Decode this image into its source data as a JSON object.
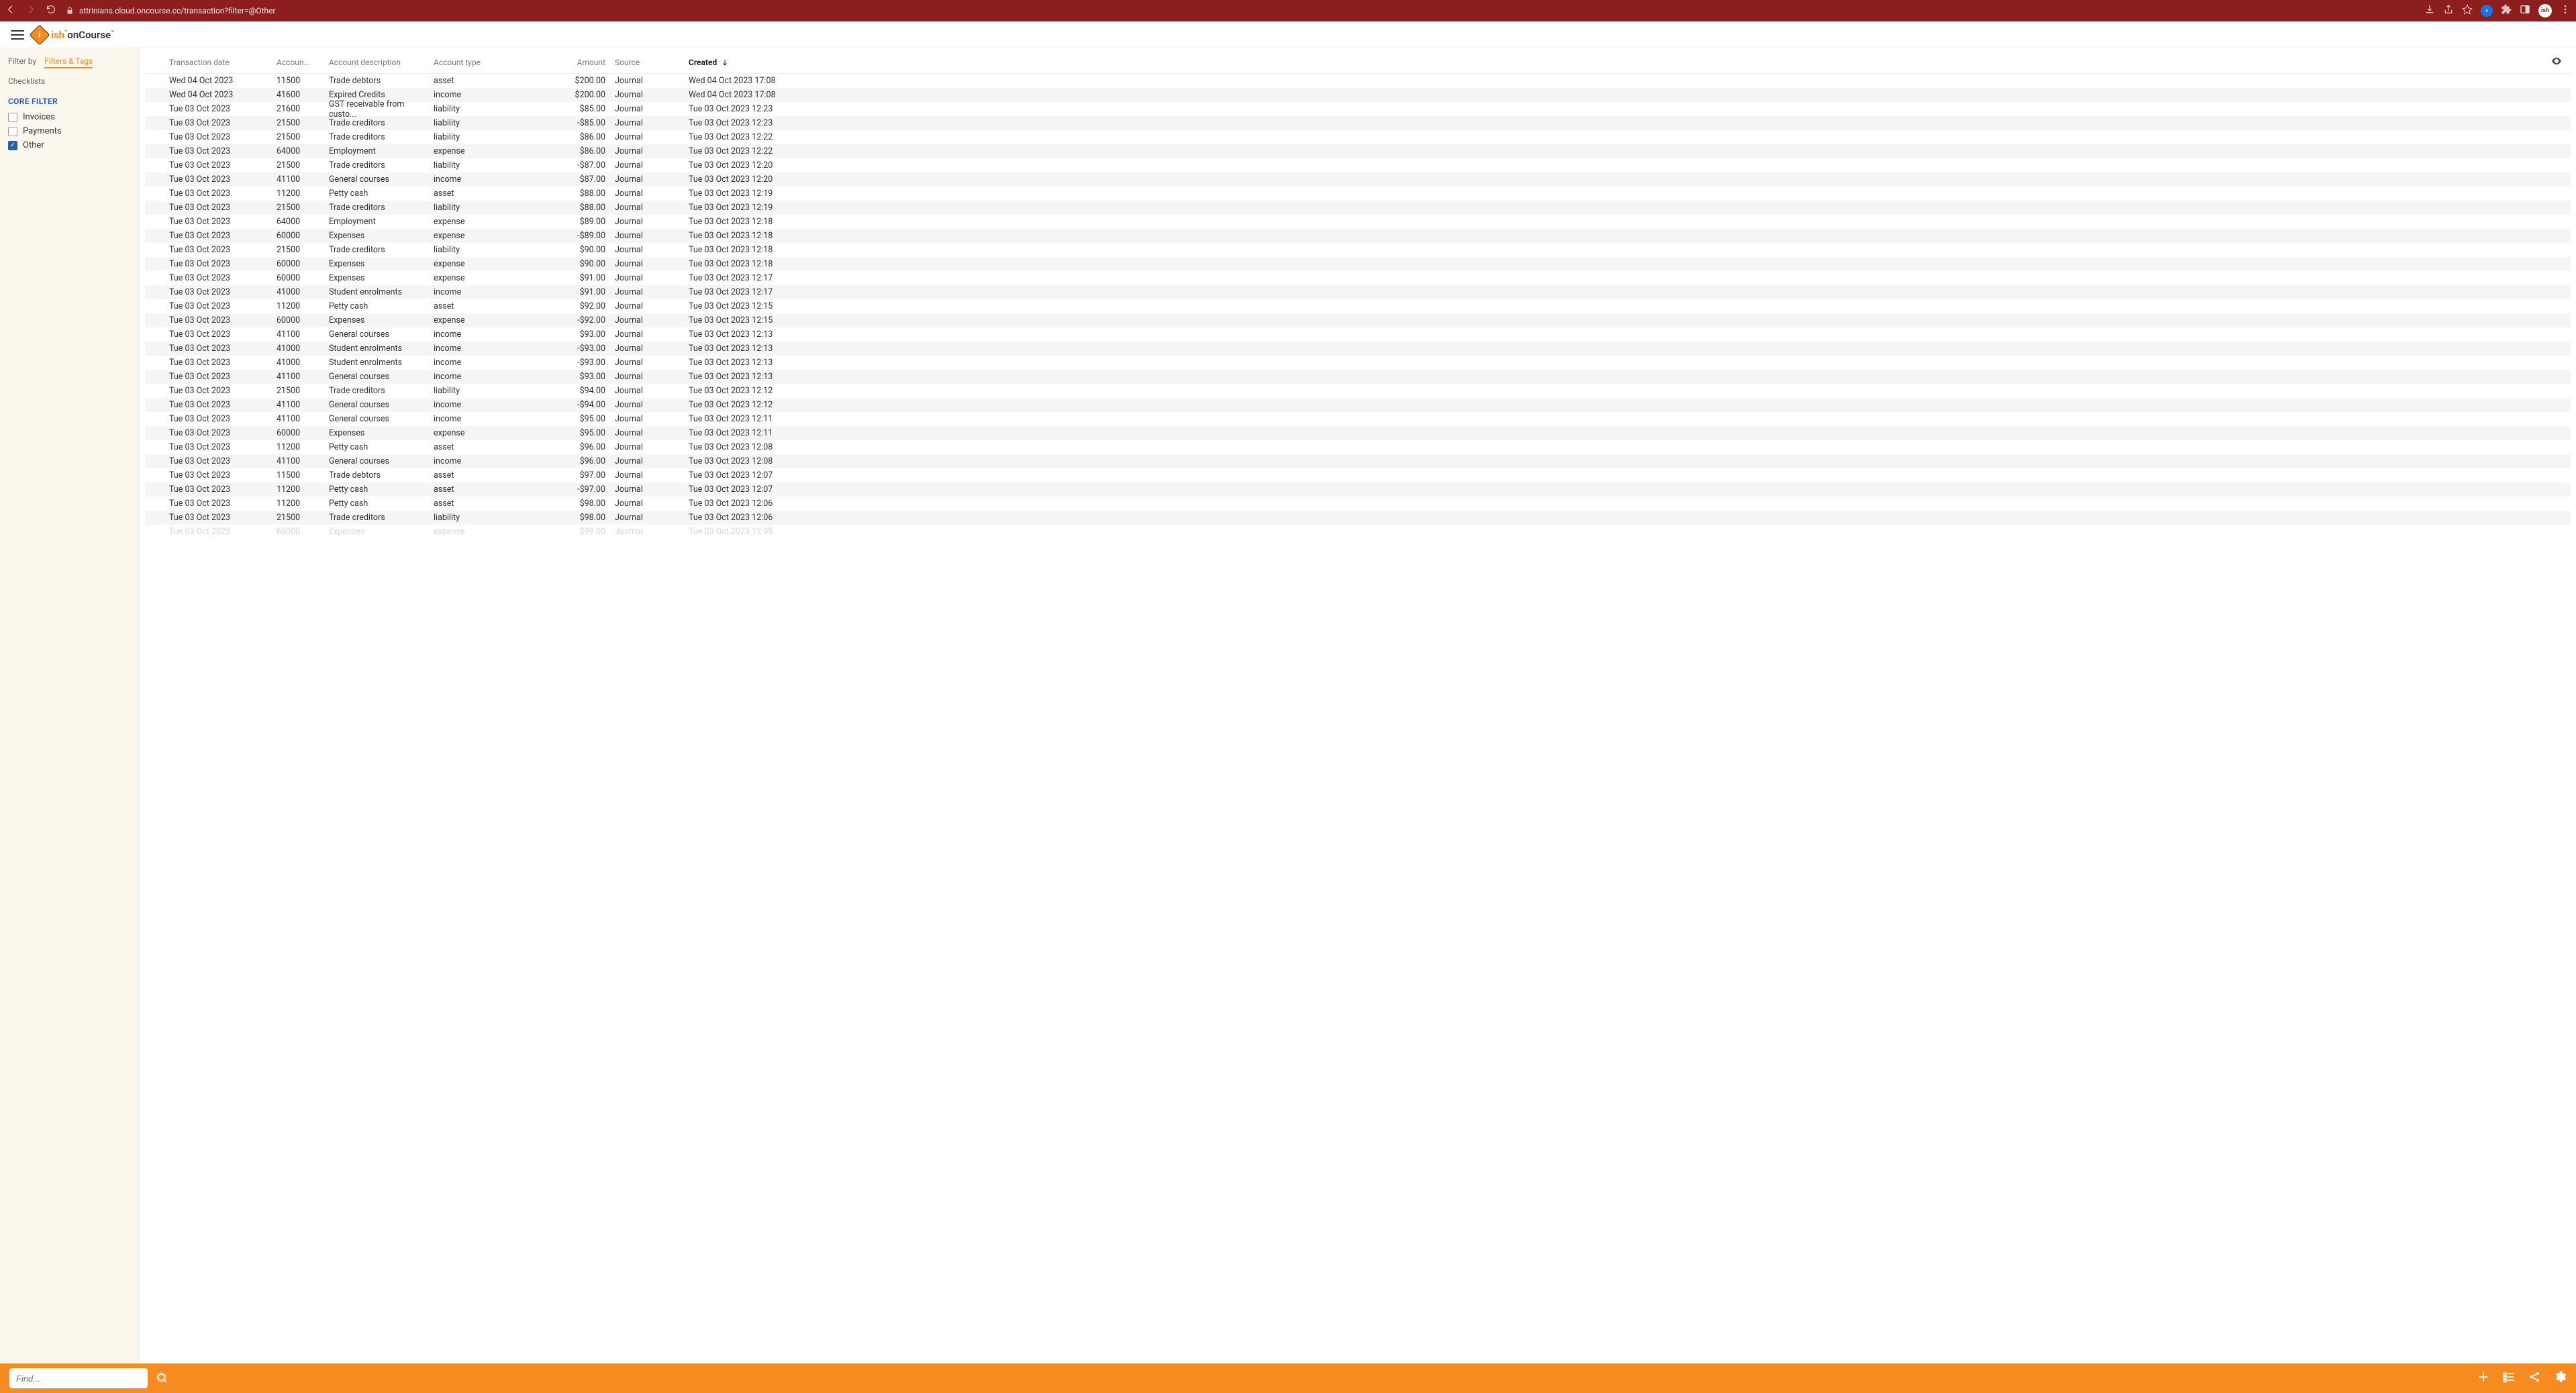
{
  "browser": {
    "url": "sttrinians.cloud.oncourse.cc/transaction?filter=@Other",
    "avatar": "ish"
  },
  "logo": {
    "ish": "ish",
    "onc": "onCourse"
  },
  "sidebar": {
    "tabs": {
      "filter_by": "Filter by",
      "filters_tags": "Filters & Tags",
      "checklists": "Checklists"
    },
    "core_title": "CORE FILTER",
    "filters": [
      {
        "label": "Invoices",
        "checked": false
      },
      {
        "label": "Payments",
        "checked": false
      },
      {
        "label": "Other",
        "checked": true
      }
    ]
  },
  "columns": {
    "date": "Transaction date",
    "accnum": "Accoun...",
    "accdesc": "Account description",
    "acctype": "Account type",
    "amount": "Amount",
    "source": "Source",
    "created": "Created"
  },
  "search_placeholder": "Find...",
  "rows": [
    {
      "date": "Wed 04 Oct 2023",
      "num": "11500",
      "desc": "Trade debtors",
      "type": "asset",
      "amount": "$200.00",
      "source": "Journal",
      "created": "Wed 04 Oct 2023 17:08"
    },
    {
      "date": "Wed 04 Oct 2023",
      "num": "41600",
      "desc": "Expired Credits",
      "type": "income",
      "amount": "$200.00",
      "source": "Journal",
      "created": "Wed 04 Oct 2023 17:08"
    },
    {
      "date": "Tue 03 Oct 2023",
      "num": "21600",
      "desc": "GST receivable from custo...",
      "type": "liability",
      "amount": "$85.00",
      "source": "Journal",
      "created": "Tue 03 Oct 2023 12:23"
    },
    {
      "date": "Tue 03 Oct 2023",
      "num": "21500",
      "desc": "Trade creditors",
      "type": "liability",
      "amount": "-$85.00",
      "source": "Journal",
      "created": "Tue 03 Oct 2023 12:23"
    },
    {
      "date": "Tue 03 Oct 2023",
      "num": "21500",
      "desc": "Trade creditors",
      "type": "liability",
      "amount": "$86.00",
      "source": "Journal",
      "created": "Tue 03 Oct 2023 12:22"
    },
    {
      "date": "Tue 03 Oct 2023",
      "num": "64000",
      "desc": "Employment",
      "type": "expense",
      "amount": "$86.00",
      "source": "Journal",
      "created": "Tue 03 Oct 2023 12:22"
    },
    {
      "date": "Tue 03 Oct 2023",
      "num": "21500",
      "desc": "Trade creditors",
      "type": "liability",
      "amount": "-$87.00",
      "source": "Journal",
      "created": "Tue 03 Oct 2023 12:20"
    },
    {
      "date": "Tue 03 Oct 2023",
      "num": "41100",
      "desc": "General courses",
      "type": "income",
      "amount": "$87.00",
      "source": "Journal",
      "created": "Tue 03 Oct 2023 12:20"
    },
    {
      "date": "Tue 03 Oct 2023",
      "num": "11200",
      "desc": "Petty cash",
      "type": "asset",
      "amount": "$88.00",
      "source": "Journal",
      "created": "Tue 03 Oct 2023 12:19"
    },
    {
      "date": "Tue 03 Oct 2023",
      "num": "21500",
      "desc": "Trade creditors",
      "type": "liability",
      "amount": "$88.00",
      "source": "Journal",
      "created": "Tue 03 Oct 2023 12:19"
    },
    {
      "date": "Tue 03 Oct 2023",
      "num": "64000",
      "desc": "Employment",
      "type": "expense",
      "amount": "$89.00",
      "source": "Journal",
      "created": "Tue 03 Oct 2023 12:18"
    },
    {
      "date": "Tue 03 Oct 2023",
      "num": "60000",
      "desc": "Expenses",
      "type": "expense",
      "amount": "-$89.00",
      "source": "Journal",
      "created": "Tue 03 Oct 2023 12:18"
    },
    {
      "date": "Tue 03 Oct 2023",
      "num": "21500",
      "desc": "Trade creditors",
      "type": "liability",
      "amount": "$90.00",
      "source": "Journal",
      "created": "Tue 03 Oct 2023 12:18"
    },
    {
      "date": "Tue 03 Oct 2023",
      "num": "60000",
      "desc": "Expenses",
      "type": "expense",
      "amount": "$90.00",
      "source": "Journal",
      "created": "Tue 03 Oct 2023 12:18"
    },
    {
      "date": "Tue 03 Oct 2023",
      "num": "60000",
      "desc": "Expenses",
      "type": "expense",
      "amount": "$91.00",
      "source": "Journal",
      "created": "Tue 03 Oct 2023 12:17"
    },
    {
      "date": "Tue 03 Oct 2023",
      "num": "41000",
      "desc": "Student enrolments",
      "type": "income",
      "amount": "$91.00",
      "source": "Journal",
      "created": "Tue 03 Oct 2023 12:17"
    },
    {
      "date": "Tue 03 Oct 2023",
      "num": "11200",
      "desc": "Petty cash",
      "type": "asset",
      "amount": "$92.00",
      "source": "Journal",
      "created": "Tue 03 Oct 2023 12:15"
    },
    {
      "date": "Tue 03 Oct 2023",
      "num": "60000",
      "desc": "Expenses",
      "type": "expense",
      "amount": "-$92.00",
      "source": "Journal",
      "created": "Tue 03 Oct 2023 12:15"
    },
    {
      "date": "Tue 03 Oct 2023",
      "num": "41100",
      "desc": "General courses",
      "type": "income",
      "amount": "$93.00",
      "source": "Journal",
      "created": "Tue 03 Oct 2023 12:13"
    },
    {
      "date": "Tue 03 Oct 2023",
      "num": "41000",
      "desc": "Student enrolments",
      "type": "income",
      "amount": "-$93.00",
      "source": "Journal",
      "created": "Tue 03 Oct 2023 12:13"
    },
    {
      "date": "Tue 03 Oct 2023",
      "num": "41000",
      "desc": "Student enrolments",
      "type": "income",
      "amount": "-$93.00",
      "source": "Journal",
      "created": "Tue 03 Oct 2023 12:13"
    },
    {
      "date": "Tue 03 Oct 2023",
      "num": "41100",
      "desc": "General courses",
      "type": "income",
      "amount": "$93.00",
      "source": "Journal",
      "created": "Tue 03 Oct 2023 12:13"
    },
    {
      "date": "Tue 03 Oct 2023",
      "num": "21500",
      "desc": "Trade creditors",
      "type": "liability",
      "amount": "$94.00",
      "source": "Journal",
      "created": "Tue 03 Oct 2023 12:12"
    },
    {
      "date": "Tue 03 Oct 2023",
      "num": "41100",
      "desc": "General courses",
      "type": "income",
      "amount": "-$94.00",
      "source": "Journal",
      "created": "Tue 03 Oct 2023 12:12"
    },
    {
      "date": "Tue 03 Oct 2023",
      "num": "41100",
      "desc": "General courses",
      "type": "income",
      "amount": "$95.00",
      "source": "Journal",
      "created": "Tue 03 Oct 2023 12:11"
    },
    {
      "date": "Tue 03 Oct 2023",
      "num": "60000",
      "desc": "Expenses",
      "type": "expense",
      "amount": "$95.00",
      "source": "Journal",
      "created": "Tue 03 Oct 2023 12:11"
    },
    {
      "date": "Tue 03 Oct 2023",
      "num": "11200",
      "desc": "Petty cash",
      "type": "asset",
      "amount": "$96.00",
      "source": "Journal",
      "created": "Tue 03 Oct 2023 12:08"
    },
    {
      "date": "Tue 03 Oct 2023",
      "num": "41100",
      "desc": "General courses",
      "type": "income",
      "amount": "$96.00",
      "source": "Journal",
      "created": "Tue 03 Oct 2023 12:08"
    },
    {
      "date": "Tue 03 Oct 2023",
      "num": "11500",
      "desc": "Trade debtors",
      "type": "asset",
      "amount": "$97.00",
      "source": "Journal",
      "created": "Tue 03 Oct 2023 12:07"
    },
    {
      "date": "Tue 03 Oct 2023",
      "num": "11200",
      "desc": "Petty cash",
      "type": "asset",
      "amount": "-$97.00",
      "source": "Journal",
      "created": "Tue 03 Oct 2023 12:07"
    },
    {
      "date": "Tue 03 Oct 2023",
      "num": "11200",
      "desc": "Petty cash",
      "type": "asset",
      "amount": "$98.00",
      "source": "Journal",
      "created": "Tue 03 Oct 2023 12:06"
    },
    {
      "date": "Tue 03 Oct 2023",
      "num": "21500",
      "desc": "Trade creditors",
      "type": "liability",
      "amount": "$98.00",
      "source": "Journal",
      "created": "Tue 03 Oct 2023 12:06"
    },
    {
      "date": "Tue 03 Oct 2023",
      "num": "60000",
      "desc": "Expenses",
      "type": "expense",
      "amount": "$99.00",
      "source": "Journal",
      "created": "Tue 03 Oct 2023 12:05"
    }
  ]
}
